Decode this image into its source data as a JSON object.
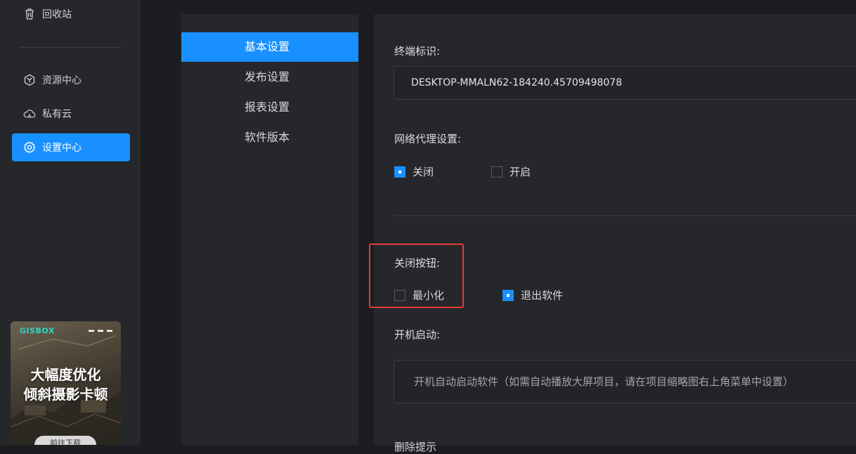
{
  "sidebar": {
    "items": [
      {
        "label": "回收站",
        "icon": "trash-icon"
      },
      {
        "label": "资源中心",
        "icon": "cube-icon"
      },
      {
        "label": "私有云",
        "icon": "cloud-icon"
      },
      {
        "label": "设置中心",
        "icon": "gear-icon",
        "active": true
      }
    ],
    "promo": {
      "brand": "GISBOX",
      "line1": "大幅度优化",
      "line2": "倾斜摄影卡顿",
      "button": "前往下载"
    }
  },
  "settings_menu": {
    "items": [
      {
        "label": "基本设置",
        "active": true
      },
      {
        "label": "发布设置"
      },
      {
        "label": "报表设置"
      },
      {
        "label": "软件版本"
      }
    ]
  },
  "main": {
    "terminal": {
      "label": "终端标识:",
      "value": "DESKTOP-MMALN62-184240.45709498078"
    },
    "proxy": {
      "label": "网络代理设置:",
      "options": [
        {
          "label": "关闭",
          "checked": true
        },
        {
          "label": "开启",
          "checked": false
        }
      ]
    },
    "close_button": {
      "label": "关闭按钮:",
      "options": [
        {
          "label": "最小化",
          "checked": false
        },
        {
          "label": "退出软件",
          "checked": true
        }
      ]
    },
    "startup": {
      "label": "开机启动:",
      "hint": "开机自动启动软件（如需自动播放大屏项目，请在项目缩略图右上角菜单中设置）"
    },
    "next_label": "删除提示"
  },
  "colors": {
    "accent": "#1890ff",
    "highlight": "#e53935",
    "panel": "#26272b",
    "background": "#1c1d20"
  }
}
